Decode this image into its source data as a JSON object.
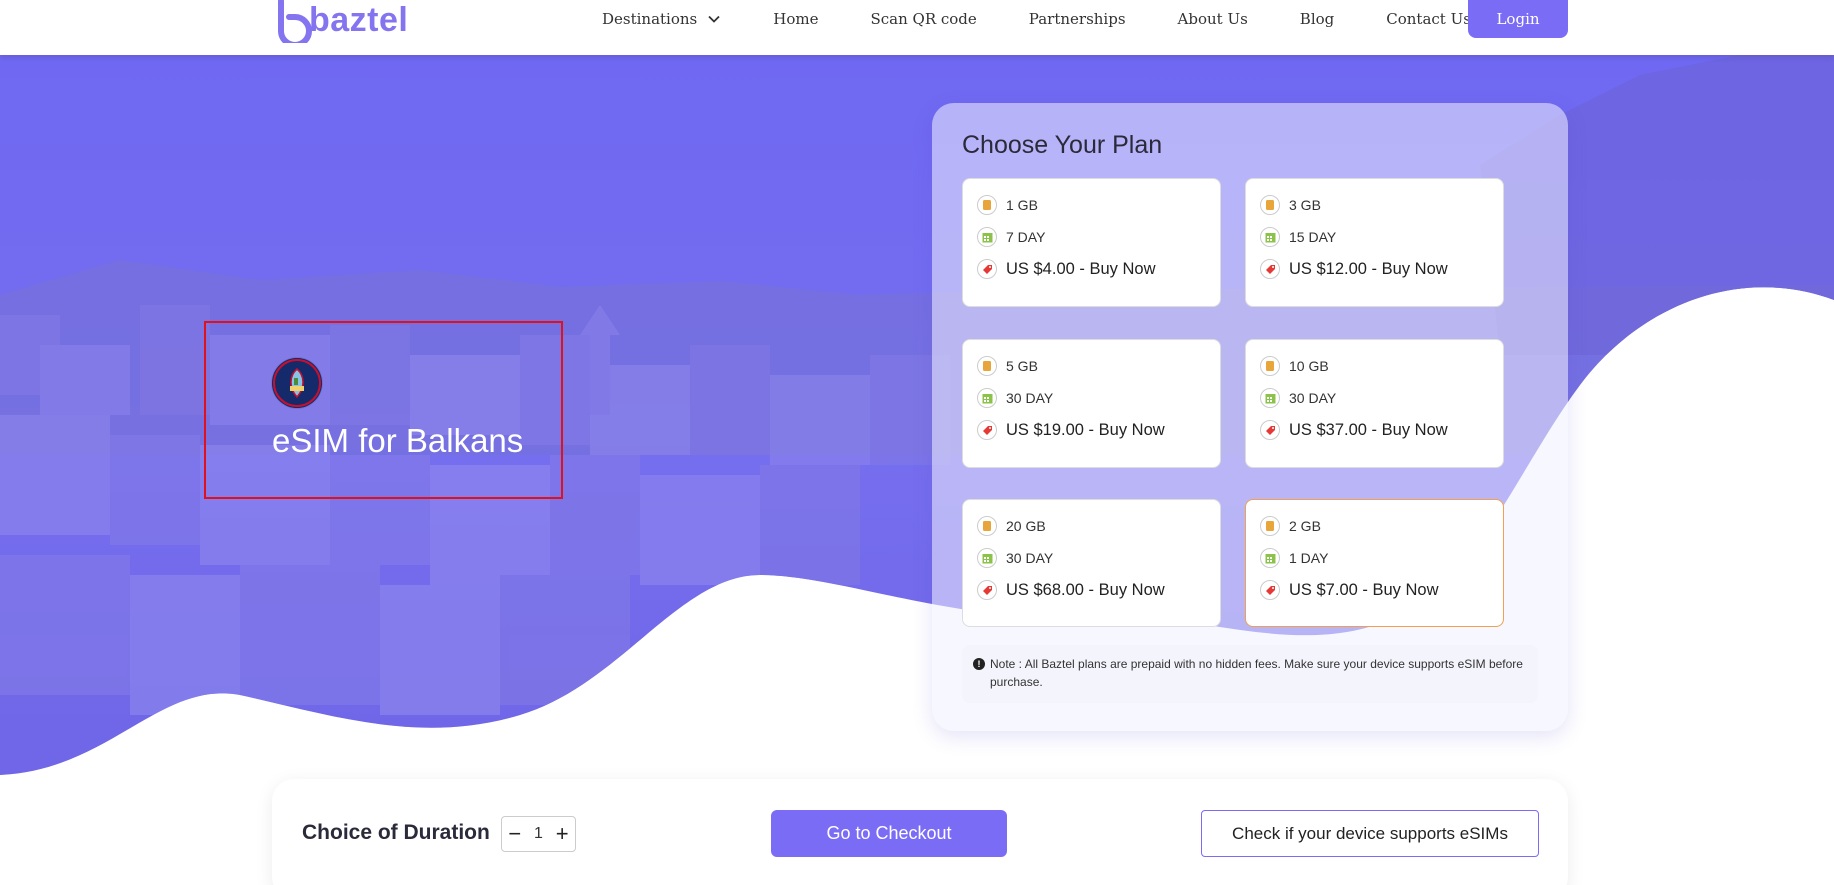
{
  "header": {
    "logo_text": "baztel",
    "nav": [
      {
        "label": "Destinations"
      },
      {
        "label": "Home"
      },
      {
        "label": "Scan QR code"
      },
      {
        "label": "Partnerships"
      },
      {
        "label": "About Us"
      },
      {
        "label": "Blog"
      },
      {
        "label": "Contact Us"
      }
    ],
    "login_label": "Login"
  },
  "hero": {
    "title": "eSIM for Balkans",
    "flag_icon": "guam-flag-icon"
  },
  "plans": {
    "title": "Choose Your Plan",
    "items": [
      {
        "data": "1 GB",
        "duration": "7 DAY",
        "price": "US $4.00 - Buy Now"
      },
      {
        "data": "3 GB",
        "duration": "15 DAY",
        "price": "US $12.00 - Buy Now"
      },
      {
        "data": "5 GB",
        "duration": "30 DAY",
        "price": "US $19.00 - Buy Now"
      },
      {
        "data": "10 GB",
        "duration": "30 DAY",
        "price": "US $37.00 - Buy Now"
      },
      {
        "data": "20 GB",
        "duration": "30 DAY",
        "price": "US $68.00 - Buy Now"
      },
      {
        "data": "2 GB",
        "duration": "1 DAY",
        "price": "US $7.00 - Buy Now",
        "selected": true
      }
    ],
    "note": "Note : All Baztel plans are prepaid with no hidden fees. Make sure your device supports eSIM before purchase."
  },
  "bottom": {
    "duration_label": "Choice of Duration",
    "minus": "−",
    "quantity": "1",
    "plus": "+",
    "checkout_label": "Go to Checkout",
    "check_label": "Check if your device supports eSIMs"
  },
  "colors": {
    "accent": "#7b6cf6",
    "hero_overlay": "#6f66f2",
    "selected_border": "#f0a050",
    "highlight": "#e0101c"
  }
}
